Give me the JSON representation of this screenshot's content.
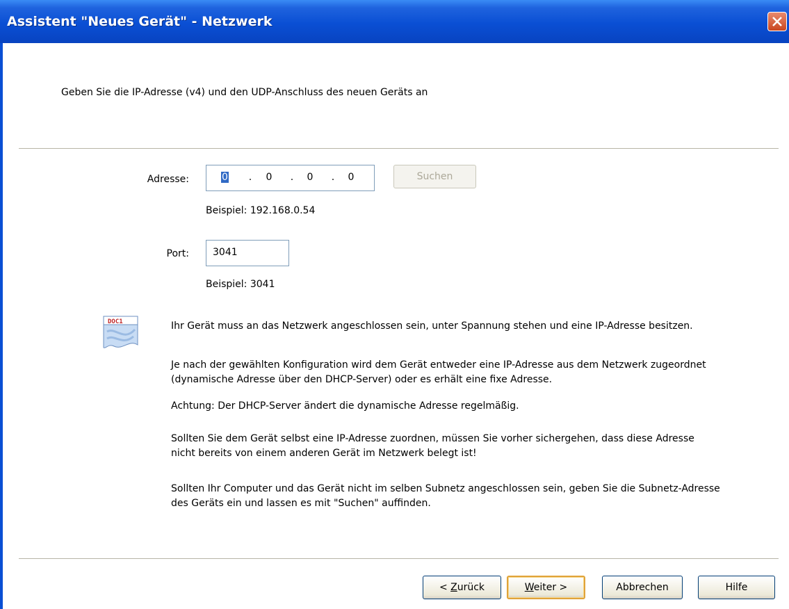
{
  "window": {
    "title": "Assistent \"Neues Gerät\" - Netzwerk"
  },
  "header": {
    "instruction": "Geben Sie die IP-Adresse (v4) und den UDP-Anschluss des neuen Geräts an"
  },
  "address": {
    "label": "Adresse:",
    "octets": [
      "0",
      "0",
      "0",
      "0"
    ],
    "dot": ".",
    "example": "Beispiel: 192.168.0.54"
  },
  "search_button": {
    "label": "Suchen",
    "enabled": false
  },
  "port": {
    "label": "Port:",
    "value": "3041",
    "example": "Beispiel: 3041"
  },
  "info_icon": {
    "icon": "doc-icon",
    "text": "DOC1"
  },
  "info": {
    "p1": "Ihr Gerät muss an das Netzwerk angeschlossen sein, unter Spannung stehen und eine IP-Adresse besitzen.",
    "p2": "Je nach der gewählten Konfiguration wird dem Gerät entweder eine IP-Adresse aus dem Netzwerk zugeordnet (dynamische Adresse über den DHCP-Server) oder es erhält eine fixe Adresse.",
    "p3": "Achtung: Der DHCP-Server ändert die dynamische Adresse regelmäßig.",
    "p4": "Sollten Sie dem Gerät selbst eine IP-Adresse zuordnen, müssen Sie vorher sichergehen, dass diese Adresse nicht bereits von einem anderen Gerät im Netzwerk belegt ist!",
    "p5": "Sollten Ihr Computer und das Gerät nicht im selben Subnetz angeschlossen sein, geben Sie die Subnetz-Adresse des Geräts ein und lassen es mit \"Suchen\" auffinden."
  },
  "buttons": {
    "back_prefix": "< ",
    "back_key": "Z",
    "back_rest": "urück",
    "next_key": "W",
    "next_rest": "eiter >",
    "cancel": "Abbrechen",
    "help": "Hilfe"
  },
  "colors": {
    "titlebar": "#0a4fd4",
    "selection": "#316ac5",
    "default_button_border": "#e0a33a"
  }
}
